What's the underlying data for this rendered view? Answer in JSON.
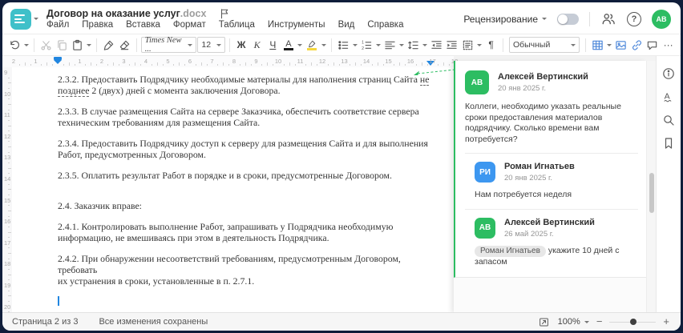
{
  "header": {
    "title": "Договор на оказание услуг",
    "title_ext": ".docx",
    "menu": [
      "Файл",
      "Правка",
      "Вставка",
      "Формат",
      "Таблица",
      "Инструменты",
      "Вид",
      "Справка"
    ],
    "review_label": "Рецензирование",
    "avatar_initials": "АВ"
  },
  "toolbar": {
    "font_name": "Times New ...",
    "font_size": "12",
    "bold": "Ж",
    "italic": "К",
    "underline": "Ч",
    "font_color": "А",
    "pilcrow": "¶",
    "style_name": "Обычный",
    "more": "···"
  },
  "ruler": {
    "left_numbers": [
      "2",
      "1"
    ],
    "numbers": [
      "1",
      "2",
      "3",
      "4",
      "5",
      "6",
      "7",
      "8",
      "9",
      "10",
      "11",
      "12",
      "13",
      "14",
      "15",
      "16",
      "17",
      "18"
    ],
    "v_numbers": [
      "9",
      "10",
      "11",
      "12",
      "13",
      "14",
      "15",
      "16",
      "17",
      "18",
      "19",
      "20"
    ]
  },
  "document": {
    "paragraphs": [
      {
        "l1_before": "2.3.2. Предоставить Подрядчику необходимые материалы для наполнения страниц Сайта ",
        "l1_anchor": "не",
        "l2_anchor": "позднее",
        "l2_after": " 2 (двух) дней с момента заключения Договора."
      },
      {
        "l1": "2.3.3. В случае размещения Сайта на сервере Заказчика, обеспечить соответствие сервера",
        "l2": "техническим требованиям для размещения Сайта."
      },
      {
        "l1": "2.3.4. Предоставить Подрядчику доступ к серверу для размещения Сайта и для выполнения",
        "l2": "Работ, предусмотренных Договором."
      },
      {
        "l1": "2.3.5. Оплатить результат Работ в порядке и в сроки, предусмотренные Договором."
      },
      {
        "l1": "2.4. Заказчик вправе:"
      },
      {
        "l1": "2.4.1. Контролировать выполнение Работ, запрашивать у Подрядчика необходимую",
        "l2": "информацию, не вмешиваясь при этом в деятельность Подрядчика."
      },
      {
        "l1": "2.4.2. При обнаружении несоответствий требованиям, предусмотренным Договором, требовать",
        "l2": "их устранения в сроки, установленные в п. 2.7.1."
      }
    ]
  },
  "comments": [
    {
      "initials": "АВ",
      "name": "Алексей Вертинский",
      "date": "20 янв 2025 г.",
      "text": "Коллеги, необходимо указать реальные сроки предоставления материалов подрядчику. Сколько времени вам потребуется?"
    },
    {
      "initials": "РИ",
      "name": "Роман Игнатьев",
      "date": "20 янв 2025 г.",
      "text": "Нам потребуется неделя"
    },
    {
      "initials": "АВ",
      "name": "Алексей Вертинский",
      "date": "26 май 2025 г.",
      "mention": "Роман Игнатьев",
      "text": " укажите 10 дней с запасом"
    }
  ],
  "statusbar": {
    "page": "Страница 2 из 3",
    "saved": "Все изменения сохранены",
    "zoom": "100%"
  },
  "colors": {
    "brand_teal": "#3fc0c9",
    "comment_green": "#2dbd62",
    "reply_blue": "#3d97f0",
    "accent_blue": "#2186e0",
    "icon_blue": "#4a85d9",
    "highlight_yellow": "#f5d73e"
  }
}
